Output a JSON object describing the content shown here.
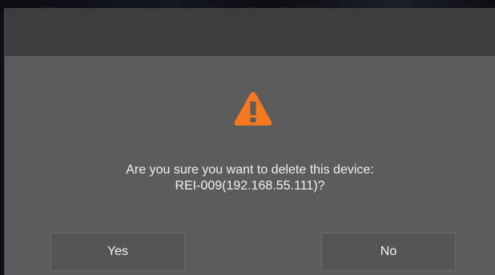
{
  "dialog": {
    "icon": "warning-triangle-icon",
    "message_line1": "Are you sure you want to delete this device:",
    "message_line2": "REI-009(192.168.55.111)?",
    "buttons": {
      "yes_label": "Yes",
      "no_label": "No"
    }
  },
  "colors": {
    "dialog_bg": "#5c5c5c",
    "titlebar_bg": "#3d3d3d",
    "warning_orange": "#f47920",
    "text": "#f0f0f0"
  }
}
